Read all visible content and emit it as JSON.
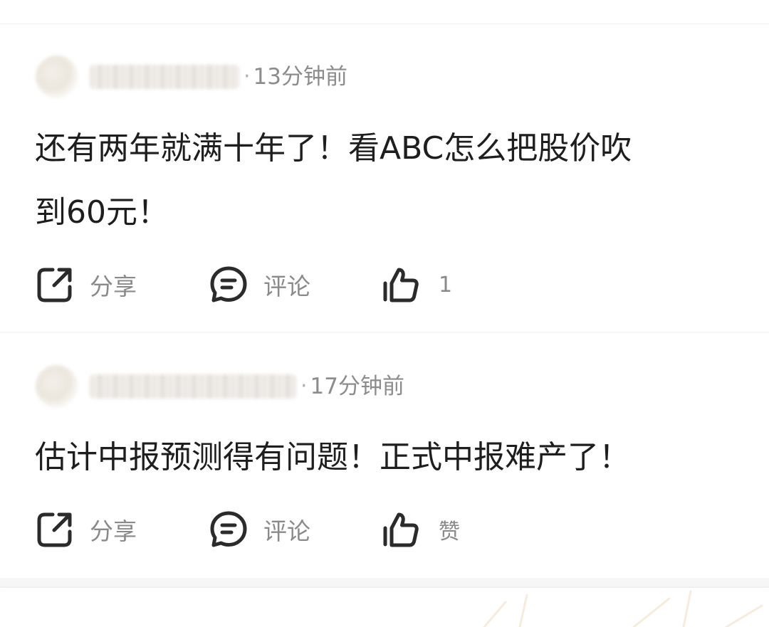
{
  "posts": [
    {
      "time": "13分钟前",
      "text_lines": [
        "还有两年就满十年了！看ABC怎么把股价吹",
        "到60元！"
      ],
      "actions": {
        "share": "分享",
        "comment": "评论",
        "like": "1"
      }
    },
    {
      "time": "17分钟前",
      "text_lines": [
        "估计中报预测得有问题！正式中报难产了！"
      ],
      "actions": {
        "share": "分享",
        "comment": "评论",
        "like": "赞"
      }
    }
  ],
  "separator": "·",
  "icons": {
    "share": "share-icon",
    "comment": "comment-icon",
    "like": "thumbs-up-icon"
  },
  "colors": {
    "text": "#1e1e1e",
    "muted": "#8a8a8a",
    "icon": "#2b2b2b"
  }
}
